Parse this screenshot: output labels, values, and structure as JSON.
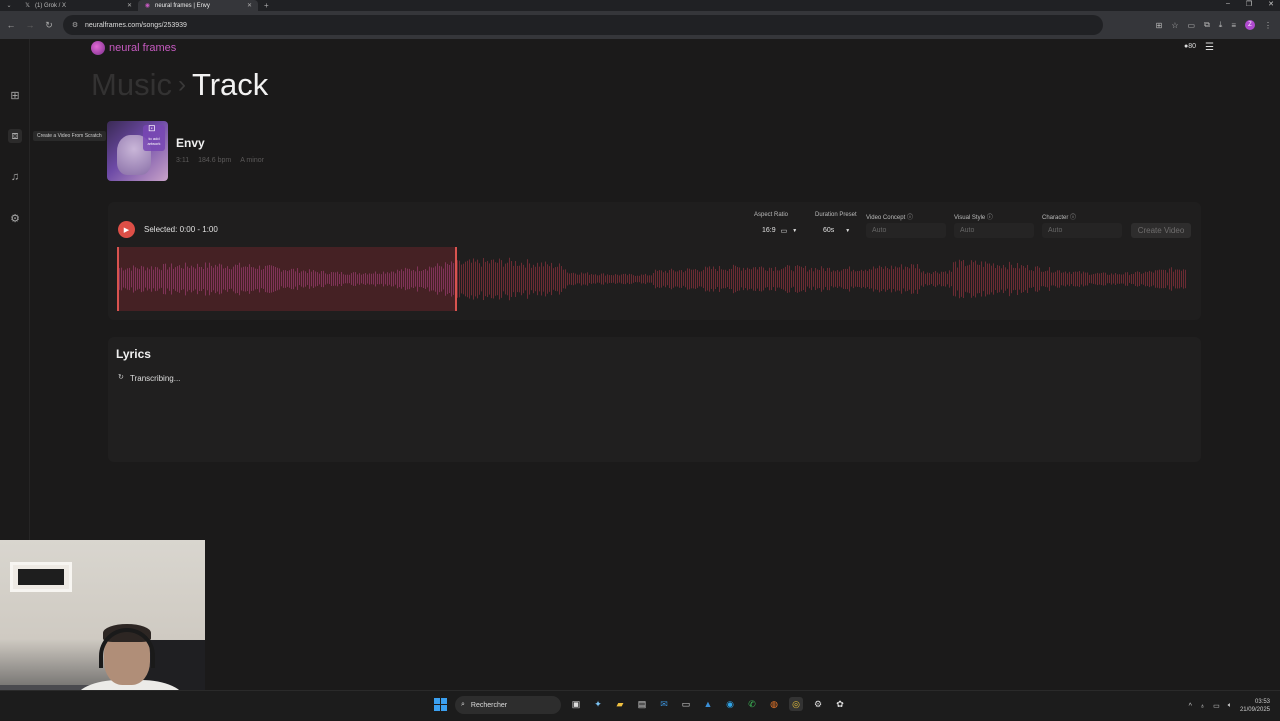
{
  "browser": {
    "tabs": [
      {
        "title": "(1) Grok / X",
        "icon": "x-logo-icon",
        "active": false
      },
      {
        "title": "neural frames | Envy",
        "icon": "neural-frames-icon",
        "active": true
      }
    ],
    "url": "neuralframes.com/songs/253939",
    "profile_initial": "Z"
  },
  "app": {
    "logo_text": "neural frames",
    "credits": "80",
    "breadcrumb": {
      "parent": "Music",
      "separator": "›",
      "current": "Track"
    },
    "sidebar_tooltip": "Create a Video From Scratch"
  },
  "song": {
    "title": "Envy",
    "duration": "3:11",
    "bpm": "184.6 bpm",
    "key": "A minor",
    "cover_badge": "to add artwork"
  },
  "player": {
    "selected": "Selected: 0:00 - 1:00",
    "selection_fraction": [
      0,
      0.3142
    ],
    "options": {
      "aspect_ratio": {
        "label": "Aspect Ratio",
        "value": "16:9"
      },
      "duration_preset": {
        "label": "Duration Preset",
        "value": "60s"
      },
      "video_concept": {
        "label": "Video Concept",
        "value": "Auto"
      },
      "visual_style": {
        "label": "Visual Style",
        "value": "Auto"
      },
      "character": {
        "label": "Character",
        "value": "Auto"
      }
    },
    "create_button": "Create Video"
  },
  "lyrics": {
    "title": "Lyrics",
    "status": "Transcribing..."
  },
  "taskbar": {
    "search_placeholder": "Rechercher",
    "time": "03:53",
    "date": "21/09/2025"
  },
  "colors": {
    "accent": "#dd4f47",
    "brand": "#c65ac0",
    "background": "#1b1a1a"
  }
}
